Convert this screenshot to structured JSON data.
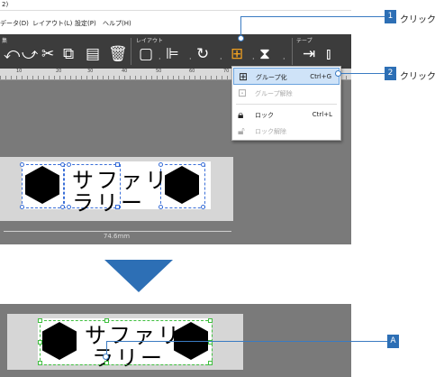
{
  "window": {
    "title_fragment": "2)"
  },
  "menu": {
    "items": [
      "データ(D)",
      "レイアウト(L)",
      "設定(P)",
      "ヘルプ(H)"
    ]
  },
  "ribbon": {
    "group_left_label": "集",
    "group_layout_label": "レイアウト",
    "group_tape_label": "テープ",
    "tools": [
      "undo-icon",
      "redo-icon",
      "cut-icon",
      "copy-icon",
      "paste-icon",
      "delete-icon",
      "frame-icon",
      "align-icon",
      "rotate-icon",
      "group-icon",
      "flip-icon",
      "tape-feed-icon",
      "tape-cut-icon"
    ]
  },
  "ruler": {
    "ticks": [
      "10",
      "20",
      "30",
      "40",
      "50",
      "60",
      "70"
    ]
  },
  "label": {
    "line1": "サファリ",
    "line2": "ラリー",
    "length": "74.6mm"
  },
  "dropdown": {
    "items": [
      {
        "label": "グループ化",
        "shortcut": "Ctrl+G",
        "icon": "group-icon",
        "enabled": true,
        "highlighted": true
      },
      {
        "label": "グループ解除",
        "shortcut": "",
        "icon": "ungroup-icon",
        "enabled": false,
        "highlighted": false
      },
      {
        "label": "ロック",
        "shortcut": "Ctrl+L",
        "icon": "lock-icon",
        "enabled": true,
        "highlighted": false
      },
      {
        "label": "ロック解除",
        "shortcut": "",
        "icon": "unlock-icon",
        "enabled": false,
        "highlighted": false
      }
    ]
  },
  "callouts": [
    {
      "badge": "1",
      "text": "クリック"
    },
    {
      "badge": "2",
      "text": "クリック"
    },
    {
      "badge": "A",
      "text": ""
    }
  ],
  "colors": {
    "accent": "#2d6fb5",
    "selection_blue": "#3a6fd8",
    "selection_green": "#3fbf3f",
    "ribbon": "#3c3c3c"
  }
}
